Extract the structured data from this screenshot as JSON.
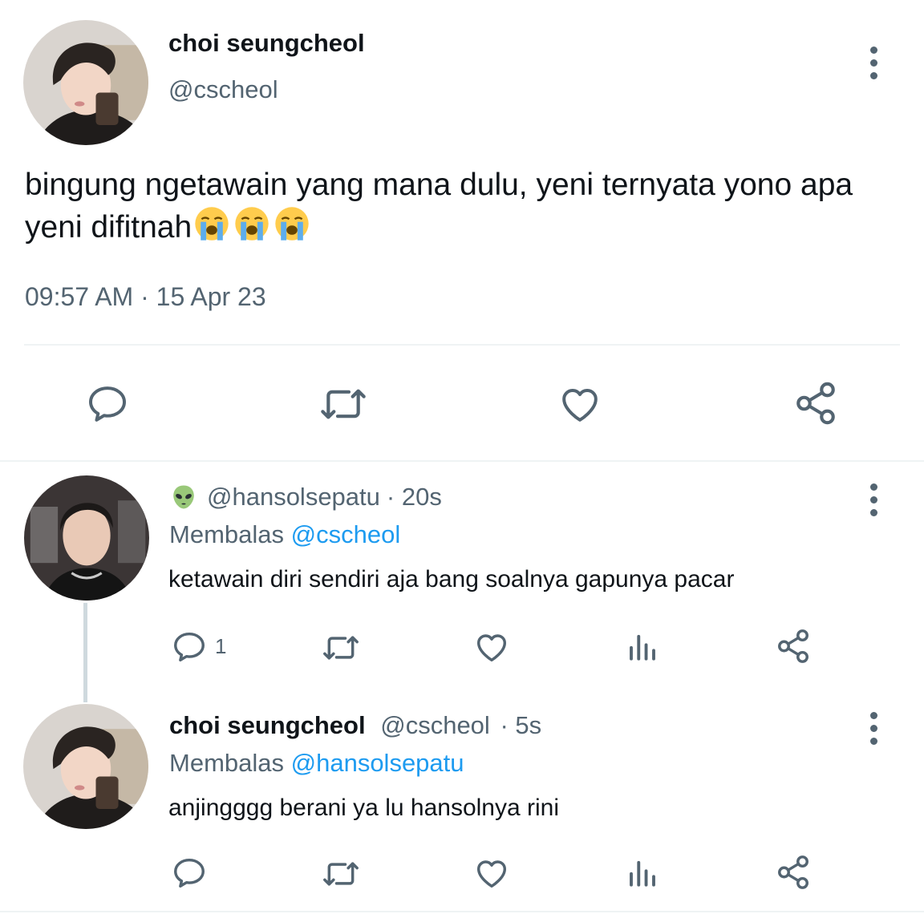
{
  "main_tweet": {
    "author_name": "choi seungcheol",
    "handle": "@cscheol",
    "text": "bingung ngetawain yang mana dulu, yeni ternyata yono apa yeni difitnah",
    "emoji_names": [
      "loudly-crying-face",
      "loudly-crying-face",
      "loudly-crying-face"
    ],
    "timestamp": "09:57 AM · 15 Apr 23",
    "actions": [
      "reply-icon",
      "retweet-icon",
      "like-icon",
      "share-icon"
    ]
  },
  "replies": [
    {
      "badge_icon": "alien-emoji-icon",
      "handle": "@hansolsepatu",
      "time": "· 20s",
      "replying_prefix": "Membalas",
      "replying_to": "@cscheol",
      "text": "ketawain diri sendiri aja bang soalnya gapunya pacar",
      "reply_count": "1",
      "actions": [
        "reply-icon",
        "retweet-icon",
        "like-icon",
        "views-icon",
        "share-icon"
      ]
    },
    {
      "author_name": "choi seungcheol",
      "handle": "@cscheol",
      "time": "· 5s",
      "replying_prefix": "Membalas",
      "replying_to": "@hansolsepatu",
      "text": "anjingggg berani ya lu hansolnya rini",
      "actions": [
        "reply-icon",
        "retweet-icon",
        "like-icon",
        "views-icon",
        "share-icon"
      ]
    }
  ],
  "colors": {
    "text": "#0f1419",
    "muted": "#536471",
    "link": "#1d9bf0",
    "divider": "#eff3f4",
    "thread_line": "#cfd9de"
  }
}
